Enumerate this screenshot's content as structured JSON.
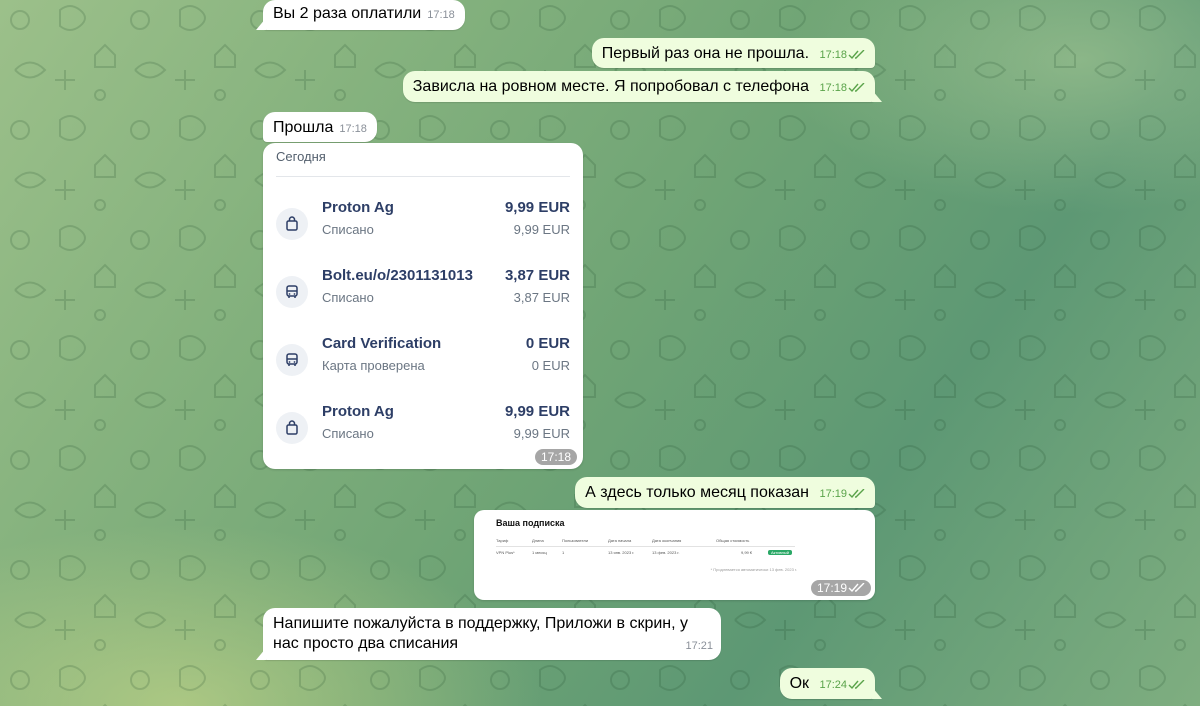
{
  "messages": {
    "m1": {
      "text": "Вы 2 раза оплатили",
      "time": "17:18"
    },
    "m2": {
      "text": "Первый раз она не прошла.",
      "time": "17:18"
    },
    "m3": {
      "text": "Зависла на ровном месте. Я попробовал с телефона",
      "time": "17:18"
    },
    "m4": {
      "text": "Прошла",
      "time": "17:18"
    },
    "m5": {
      "text": "А здесь только месяц показан",
      "time": "17:19"
    },
    "m6": {
      "time": "17:19"
    },
    "m7": {
      "text": "Напишите пожалуйста в поддержку, Приложи в скрин, у нас просто два списания",
      "time": "17:21"
    },
    "m8": {
      "text": "Ок",
      "time": "17:24"
    }
  },
  "payments_card": {
    "header": "Сегодня",
    "time": "17:18",
    "transactions": [
      {
        "name": "Proton Ag",
        "status": "Списано",
        "amount": "9,99 EUR",
        "amount_sub": "9,99 EUR",
        "icon": "shopping-bag-icon"
      },
      {
        "name": "Bolt.eu/o/2301131013",
        "status": "Списано",
        "amount": "3,87 EUR",
        "amount_sub": "3,87 EUR",
        "icon": "bus-icon"
      },
      {
        "name": "Card Verification",
        "status": "Карта проверена",
        "amount": "0 EUR",
        "amount_sub": "0 EUR",
        "icon": "bus-icon"
      },
      {
        "name": "Proton Ag",
        "status": "Списано",
        "amount": "9,99 EUR",
        "amount_sub": "9,99 EUR",
        "icon": "shopping-bag-icon"
      }
    ]
  },
  "subscription_screenshot": {
    "title": "Ваша подписка",
    "headers": [
      "Тариф",
      "Длина",
      "Пользователи",
      "Дата начала",
      "Дата окончания",
      "Общая стоимость"
    ],
    "row": [
      "VPN Plus*",
      "1 месяц",
      "1",
      "13 янв. 2023 г.",
      "13 фев. 2023 г.",
      "9,99 €"
    ],
    "badge": "Активный",
    "note": "* Продлевается автоматически 13 фев. 2023 г."
  },
  "colors": {
    "incoming_bubble": "#ffffff",
    "outgoing_bubble": "#effdde",
    "outgoing_time": "#5aa34a",
    "card_text": "#2d3e66"
  }
}
